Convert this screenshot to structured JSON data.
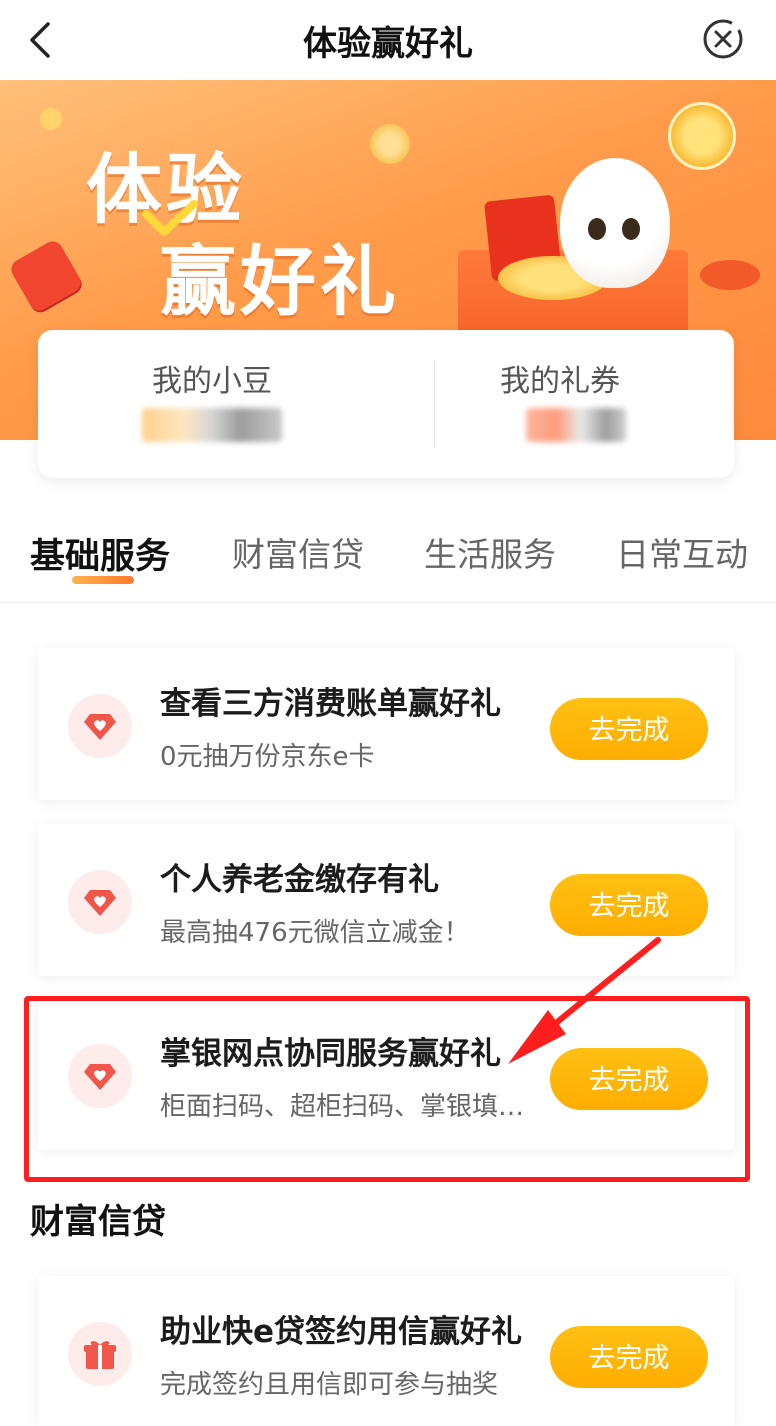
{
  "header": {
    "title": "体验赢好礼",
    "back_icon": "chevron-left-icon",
    "close_icon": "close-circle-icon"
  },
  "hero": {
    "title_line1": "体验",
    "title_line2": "赢好礼"
  },
  "stats": {
    "beans_label": "我的小豆",
    "coupons_label": "我的礼券"
  },
  "tabs": [
    {
      "label": "基础服务",
      "active": true
    },
    {
      "label": "财富信贷",
      "active": false
    },
    {
      "label": "生活服务",
      "active": false
    },
    {
      "label": "日常互动",
      "active": false
    }
  ],
  "tasks": [
    {
      "title": "查看三方消费账单赢好礼",
      "subtitle": "0元抽万份京东e卡",
      "button": "去完成",
      "icon": "diamond-heart-icon"
    },
    {
      "title": "个人养老金缴存有礼",
      "subtitle": "最高抽476元微信立减金！",
      "button": "去完成",
      "icon": "diamond-heart-icon"
    },
    {
      "title": "掌银网点协同服务赢好礼",
      "subtitle": "柜面扫码、超柜扫码、掌银填写...",
      "button": "去完成",
      "icon": "diamond-heart-icon"
    }
  ],
  "section2": {
    "title": "财富信贷",
    "tasks": [
      {
        "title": "助业快e贷签约用信赢好礼",
        "subtitle": "完成签约且用信即可参与抽奖",
        "button": "去完成",
        "icon": "gift-icon"
      }
    ]
  },
  "colors": {
    "accent": "#ff8a3c",
    "button": "#ffb000",
    "highlight": "#ff1e1e"
  }
}
